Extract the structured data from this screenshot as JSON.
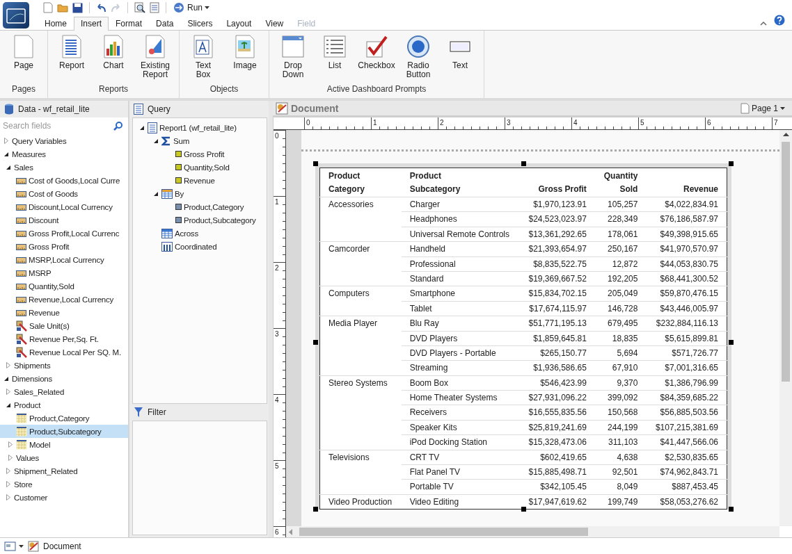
{
  "quick_access": {
    "run_label": "Run"
  },
  "tabs": [
    {
      "label": "Home",
      "selected": false,
      "disabled": false
    },
    {
      "label": "Insert",
      "selected": true,
      "disabled": false
    },
    {
      "label": "Format",
      "selected": false,
      "disabled": false
    },
    {
      "label": "Data",
      "selected": false,
      "disabled": false
    },
    {
      "label": "Slicers",
      "selected": false,
      "disabled": false
    },
    {
      "label": "Layout",
      "selected": false,
      "disabled": false
    },
    {
      "label": "View",
      "selected": false,
      "disabled": false
    },
    {
      "label": "Field",
      "selected": false,
      "disabled": true
    }
  ],
  "ribbon": [
    {
      "label": "Pages",
      "buttons": [
        {
          "label": "Page",
          "kind": "page"
        }
      ]
    },
    {
      "label": "Reports",
      "buttons": [
        {
          "label": "Report",
          "kind": "report"
        },
        {
          "label": "Chart",
          "kind": "chart"
        },
        {
          "label": "Existing\nReport",
          "kind": "existing"
        }
      ]
    },
    {
      "label": "Objects",
      "buttons": [
        {
          "label": "Text\nBox",
          "kind": "textbox"
        },
        {
          "label": "Image",
          "kind": "image"
        }
      ]
    },
    {
      "label": "Active Dashboard Prompts",
      "buttons": [
        {
          "label": "Drop\nDown",
          "kind": "dropdown"
        },
        {
          "label": "List",
          "kind": "list"
        },
        {
          "label": "Checkbox",
          "kind": "checkbox"
        },
        {
          "label": "Radio\nButton",
          "kind": "radio"
        },
        {
          "label": "Text",
          "kind": "text"
        }
      ]
    }
  ],
  "data_panel": {
    "title": "Data - wf_retail_lite",
    "search_placeholder": "Search fields",
    "tree": [
      {
        "label": "Query Variables",
        "expanded": false,
        "selected": false
      },
      {
        "label": "Measures",
        "expanded": true,
        "selected": false,
        "children": [
          {
            "label": "Sales",
            "expanded": true,
            "selected": false,
            "children": [
              {
                "label": "Cost of Goods,Local Curre",
                "kind": "measure",
                "selected": false
              },
              {
                "label": "Cost of Goods",
                "kind": "measure",
                "selected": false
              },
              {
                "label": "Discount,Local Currency",
                "kind": "measure",
                "selected": false
              },
              {
                "label": "Discount",
                "kind": "measure",
                "selected": false
              },
              {
                "label": "Gross Profit,Local Currenc",
                "kind": "measure",
                "selected": false
              },
              {
                "label": "Gross Profit",
                "kind": "measure",
                "selected": false
              },
              {
                "label": "MSRP,Local Currency",
                "kind": "measure",
                "selected": false
              },
              {
                "label": "MSRP",
                "kind": "measure",
                "selected": false
              },
              {
                "label": "Quantity,Sold",
                "kind": "measure",
                "selected": false
              },
              {
                "label": "Revenue,Local Currency",
                "kind": "measure",
                "selected": false
              },
              {
                "label": "Revenue",
                "kind": "measure",
                "selected": false
              },
              {
                "label": "Sale Unit(s)",
                "kind": "computed",
                "selected": false
              },
              {
                "label": "Revenue Per,Sq. Ft.",
                "kind": "computed",
                "selected": false
              },
              {
                "label": "Revenue Local Per SQ. M.",
                "kind": "computed",
                "selected": false
              }
            ]
          },
          {
            "label": "Shipments",
            "expanded": false,
            "selected": false
          }
        ]
      },
      {
        "label": "Dimensions",
        "expanded": true,
        "selected": false,
        "children": [
          {
            "label": "Sales_Related",
            "expanded": false,
            "selected": false
          },
          {
            "label": "Product",
            "expanded": true,
            "selected": false,
            "children": [
              {
                "label": "Product,Category",
                "kind": "dimension",
                "selected": false
              },
              {
                "label": "Product,Subcategory",
                "kind": "dimension",
                "selected": true
              },
              {
                "label": "Model",
                "kind": "dimension",
                "expanded": false,
                "selected": false
              },
              {
                "label": "Values",
                "expanded": false,
                "selected": false
              }
            ]
          },
          {
            "label": "Shipment_Related",
            "expanded": false,
            "selected": false
          },
          {
            "label": "Store",
            "expanded": false,
            "selected": false
          },
          {
            "label": "Customer",
            "expanded": false,
            "selected": false
          }
        ]
      }
    ]
  },
  "query_panel": {
    "title": "Query",
    "tree": [
      {
        "label": "Report1 (wf_retail_lite)",
        "kind": "report",
        "expanded": true,
        "children": [
          {
            "label": "Sum",
            "kind": "sum",
            "expanded": true,
            "children": [
              {
                "label": "Gross Profit",
                "kind": "measure_field"
              },
              {
                "label": "Quantity,Sold",
                "kind": "measure_field"
              },
              {
                "label": "Revenue",
                "kind": "measure_field"
              }
            ]
          },
          {
            "label": "By",
            "kind": "by",
            "expanded": true,
            "children": [
              {
                "label": "Product,Category",
                "kind": "dim_field"
              },
              {
                "label": "Product,Subcategory",
                "kind": "dim_field"
              }
            ]
          },
          {
            "label": "Across",
            "kind": "across"
          },
          {
            "label": "Coordinated",
            "kind": "coordinated"
          }
        ]
      }
    ]
  },
  "filter_panel": {
    "title": "Filter"
  },
  "document": {
    "title": "Document",
    "page_label": "Page 1",
    "ruler_h": [
      "0",
      "1",
      "2",
      "3",
      "4",
      "5",
      "6",
      "7"
    ],
    "ruler_v": [
      "0",
      "1",
      "2",
      "3",
      "4",
      "5",
      "6"
    ],
    "columns": [
      "Product\nCategory",
      "Product\nSubcategory",
      "Gross Profit",
      "Quantity\nSold",
      "Revenue"
    ],
    "groups": [
      {
        "category": "Accessories",
        "rows": [
          [
            "Charger",
            "$1,970,123.91",
            "105,257",
            "$4,022,834.91"
          ],
          [
            "Headphones",
            "$24,523,023.97",
            "228,349",
            "$76,186,587.97"
          ],
          [
            "Universal Remote Controls",
            "$13,361,292.65",
            "178,061",
            "$49,398,915.65"
          ]
        ]
      },
      {
        "category": "Camcorder",
        "rows": [
          [
            "Handheld",
            "$21,393,654.97",
            "250,167",
            "$41,970,570.97"
          ],
          [
            "Professional",
            "$8,835,522.75",
            "12,872",
            "$44,053,830.75"
          ],
          [
            "Standard",
            "$19,369,667.52",
            "192,205",
            "$68,441,300.52"
          ]
        ]
      },
      {
        "category": "Computers",
        "rows": [
          [
            "Smartphone",
            "$15,834,702.15",
            "205,049",
            "$59,870,476.15"
          ],
          [
            "Tablet",
            "$17,674,115.97",
            "146,728",
            "$43,446,005.97"
          ]
        ]
      },
      {
        "category": "Media Player",
        "rows": [
          [
            "Blu Ray",
            "$51,771,195.13",
            "679,495",
            "$232,884,116.13"
          ],
          [
            "DVD Players",
            "$1,859,645.81",
            "18,835",
            "$5,615,899.81"
          ],
          [
            "DVD Players - Portable",
            "$265,150.77",
            "5,694",
            "$571,726.77"
          ],
          [
            "Streaming",
            "$1,936,586.65",
            "67,910",
            "$7,001,316.65"
          ]
        ]
      },
      {
        "category": "Stereo Systems",
        "rows": [
          [
            "Boom Box",
            "$546,423.99",
            "9,370",
            "$1,386,796.99"
          ],
          [
            "Home Theater Systems",
            "$27,931,096.22",
            "399,092",
            "$84,359,685.22"
          ],
          [
            "Receivers",
            "$16,555,835.56",
            "150,568",
            "$56,885,503.56"
          ],
          [
            "Speaker Kits",
            "$25,819,241.69",
            "244,199",
            "$107,215,381.69"
          ],
          [
            "iPod Docking Station",
            "$15,328,473.06",
            "311,103",
            "$41,447,566.06"
          ]
        ]
      },
      {
        "category": "Televisions",
        "rows": [
          [
            "CRT TV",
            "$602,419.65",
            "4,638",
            "$2,530,835.65"
          ],
          [
            "Flat Panel TV",
            "$15,885,498.71",
            "92,501",
            "$74,962,843.71"
          ],
          [
            "Portable TV",
            "$342,105.45",
            "8,049",
            "$887,453.45"
          ]
        ]
      },
      {
        "category": "Video Production",
        "rows": [
          [
            "Video Editing",
            "$17,947,619.62",
            "199,749",
            "$58,053,276.62"
          ]
        ]
      }
    ]
  },
  "status_bar": {
    "label": "Document"
  }
}
